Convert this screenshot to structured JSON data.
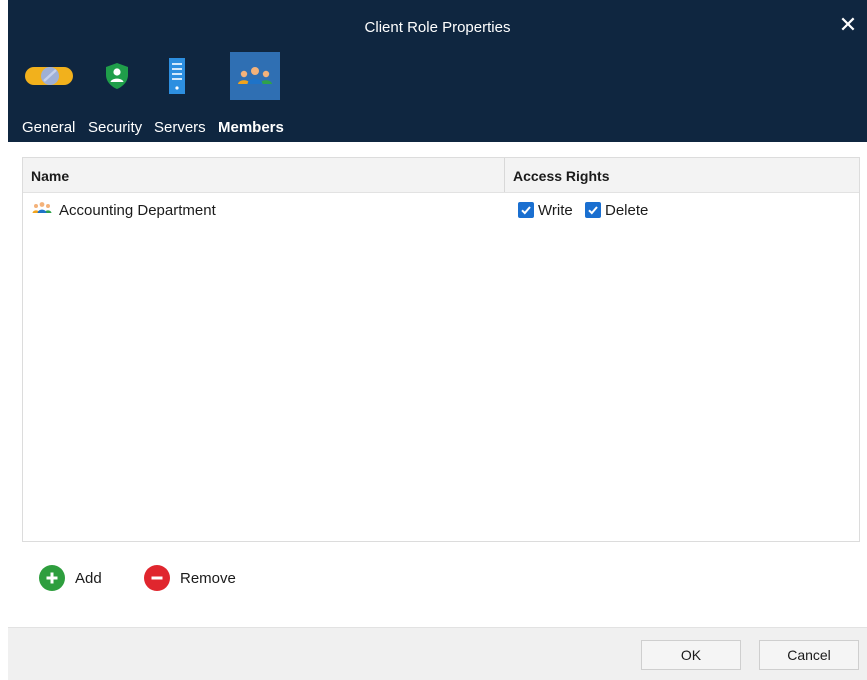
{
  "window": {
    "title": "Client Role Properties",
    "close_glyph": "✕"
  },
  "tabs": [
    {
      "label": "General",
      "icon": "toggle-icon",
      "active": false
    },
    {
      "label": "Security",
      "icon": "shield-user-icon",
      "active": false
    },
    {
      "label": "Servers",
      "icon": "server-icon",
      "active": false
    },
    {
      "label": "Members",
      "icon": "group-users-icon",
      "active": true
    }
  ],
  "grid": {
    "columns": [
      "Name",
      "Access Rights"
    ],
    "rows": [
      {
        "name": "Accounting Department",
        "icon": "group-users-icon",
        "write_label": "Write",
        "write_checked": true,
        "delete_label": "Delete",
        "delete_checked": true
      }
    ]
  },
  "actions": {
    "add_label": "Add",
    "remove_label": "Remove"
  },
  "footer": {
    "ok_label": "OK",
    "cancel_label": "Cancel"
  },
  "colors": {
    "titlebar": "#0f2640",
    "active_tab": "#2f6fb3",
    "checkbox": "#1a6fd0",
    "add": "#2e9e3e",
    "remove": "#e0262e"
  }
}
